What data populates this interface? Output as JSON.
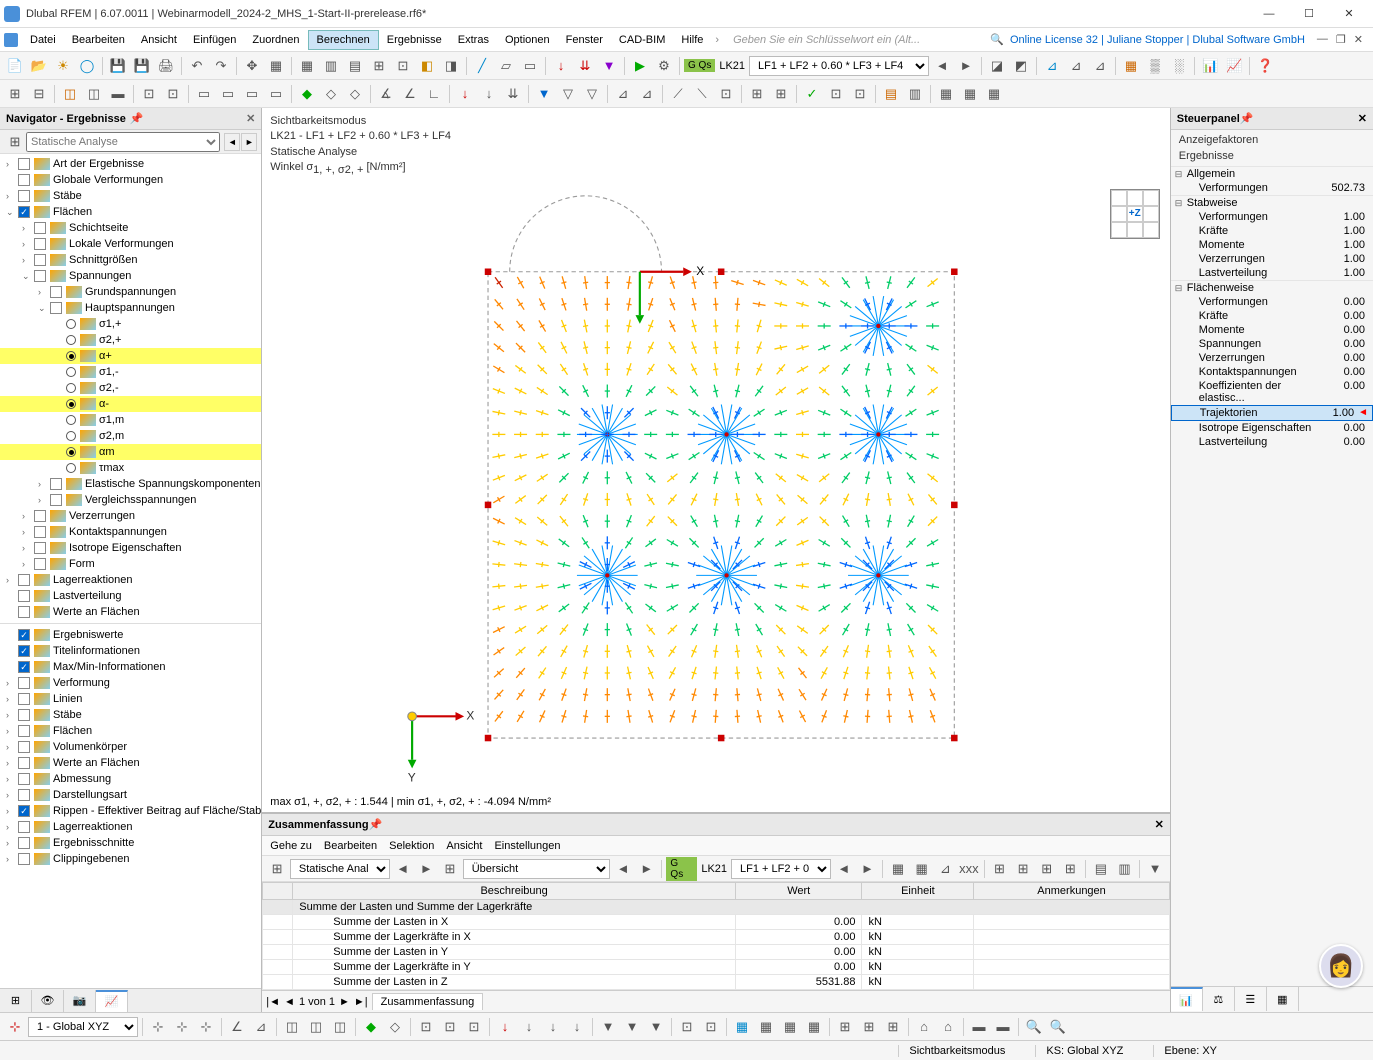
{
  "title": "Dlubal RFEM | 6.07.0011 | Webinarmodell_2024-2_MHS_1-Start-II-prerelease.rf6*",
  "menu": {
    "items": [
      "Datei",
      "Bearbeiten",
      "Ansicht",
      "Einfügen",
      "Zuordnen",
      "Berechnen",
      "Ergebnisse",
      "Extras",
      "Optionen",
      "Fenster",
      "CAD-BIM",
      "Hilfe"
    ],
    "active": "Berechnen",
    "search_placeholder": "Geben Sie ein Schlüsselwort ein (Alt...",
    "license": "Online License 32 | Juliane Stopper | Dlubal Software GmbH"
  },
  "toolbar2": {
    "green": "G Qs",
    "lk": "LK21",
    "combo": "LF1 + LF2 + 0.60 * LF3 + LF4"
  },
  "navigator": {
    "title": "Navigator - Ergebnisse",
    "combo": "Statische Analyse",
    "tree": [
      {
        "ind": 0,
        "exp": ">",
        "chk": false,
        "ico": "list",
        "lbl": "Art der Ergebnisse"
      },
      {
        "ind": 0,
        "exp": "",
        "chk": false,
        "ico": "globe",
        "lbl": "Globale Verformungen"
      },
      {
        "ind": 0,
        "exp": ">",
        "chk": false,
        "ico": "bar",
        "lbl": "Stäbe"
      },
      {
        "ind": 0,
        "exp": "v",
        "chk": true,
        "ico": "surf",
        "lbl": "Flächen"
      },
      {
        "ind": 1,
        "exp": ">",
        "chk": false,
        "ico": "surf",
        "lbl": "Schichtseite"
      },
      {
        "ind": 1,
        "exp": ">",
        "chk": false,
        "ico": "surf",
        "lbl": "Lokale Verformungen"
      },
      {
        "ind": 1,
        "exp": ">",
        "chk": false,
        "ico": "surf",
        "lbl": "Schnittgrößen"
      },
      {
        "ind": 1,
        "exp": "v",
        "chk": false,
        "ico": "surf",
        "lbl": "Spannungen"
      },
      {
        "ind": 2,
        "exp": ">",
        "chk": false,
        "ico": "surf",
        "lbl": "Grundspannungen"
      },
      {
        "ind": 2,
        "exp": "v",
        "chk": false,
        "ico": "surf",
        "lbl": "Hauptspannungen"
      },
      {
        "ind": 3,
        "radio": false,
        "ico": "surf",
        "lbl": "σ1,+"
      },
      {
        "ind": 3,
        "radio": false,
        "ico": "surf",
        "lbl": "σ2,+"
      },
      {
        "ind": 3,
        "radio": true,
        "ico": "surf",
        "lbl": "α+",
        "hl": true
      },
      {
        "ind": 3,
        "radio": false,
        "ico": "surf",
        "lbl": "σ1,-"
      },
      {
        "ind": 3,
        "radio": false,
        "ico": "surf",
        "lbl": "σ2,-"
      },
      {
        "ind": 3,
        "radio": true,
        "ico": "surf",
        "lbl": "α-",
        "hl": true
      },
      {
        "ind": 3,
        "radio": false,
        "ico": "surf",
        "lbl": "σ1,m"
      },
      {
        "ind": 3,
        "radio": false,
        "ico": "surf",
        "lbl": "σ2,m"
      },
      {
        "ind": 3,
        "radio": true,
        "ico": "surf",
        "lbl": "αm",
        "hl": true
      },
      {
        "ind": 3,
        "radio": false,
        "ico": "surf",
        "lbl": "τmax"
      },
      {
        "ind": 2,
        "exp": ">",
        "chk": false,
        "ico": "surf",
        "lbl": "Elastische Spannungskomponenten"
      },
      {
        "ind": 2,
        "exp": ">",
        "chk": false,
        "ico": "surf",
        "lbl": "Vergleichsspannungen"
      },
      {
        "ind": 1,
        "exp": ">",
        "chk": false,
        "ico": "surf",
        "lbl": "Verzerrungen"
      },
      {
        "ind": 1,
        "exp": ">",
        "chk": false,
        "ico": "surf",
        "lbl": "Kontaktspannungen"
      },
      {
        "ind": 1,
        "exp": ">",
        "chk": false,
        "ico": "surf",
        "lbl": "Isotrope Eigenschaften"
      },
      {
        "ind": 1,
        "exp": ">",
        "chk": false,
        "ico": "surf",
        "lbl": "Form"
      },
      {
        "ind": 0,
        "exp": ">",
        "chk": false,
        "ico": "sup",
        "lbl": "Lagerreaktionen"
      },
      {
        "ind": 0,
        "exp": "",
        "chk": false,
        "ico": "load",
        "lbl": "Lastverteilung"
      },
      {
        "ind": 0,
        "exp": "",
        "chk": false,
        "ico": "xx",
        "lbl": "Werte an Flächen"
      },
      {
        "ind": -1,
        "sep": true
      },
      {
        "ind": 0,
        "exp": "",
        "chk": true,
        "ico": "xx",
        "lbl": "Ergebniswerte"
      },
      {
        "ind": 0,
        "exp": "",
        "chk": true,
        "ico": "title",
        "lbl": "Titelinformationen"
      },
      {
        "ind": 0,
        "exp": "",
        "chk": true,
        "ico": "mm",
        "lbl": "Max/Min-Informationen"
      },
      {
        "ind": 0,
        "exp": ">",
        "chk": false,
        "ico": "def",
        "lbl": "Verformung"
      },
      {
        "ind": 0,
        "exp": ">",
        "chk": false,
        "ico": "line",
        "lbl": "Linien"
      },
      {
        "ind": 0,
        "exp": ">",
        "chk": false,
        "ico": "bar",
        "lbl": "Stäbe"
      },
      {
        "ind": 0,
        "exp": ">",
        "chk": false,
        "ico": "surf",
        "lbl": "Flächen"
      },
      {
        "ind": 0,
        "exp": ">",
        "chk": false,
        "ico": "vol",
        "lbl": "Volumenkörper"
      },
      {
        "ind": 0,
        "exp": ">",
        "chk": false,
        "ico": "xx",
        "lbl": "Werte an Flächen"
      },
      {
        "ind": 0,
        "exp": ">",
        "chk": false,
        "ico": "dim",
        "lbl": "Abmessung"
      },
      {
        "ind": 0,
        "exp": ">",
        "chk": false,
        "ico": "disp",
        "lbl": "Darstellungsart"
      },
      {
        "ind": 0,
        "exp": ">",
        "chk": true,
        "ico": "rib",
        "lbl": "Rippen - Effektiver Beitrag auf Fläche/Stab"
      },
      {
        "ind": 0,
        "exp": ">",
        "chk": false,
        "ico": "sup",
        "lbl": "Lagerreaktionen"
      },
      {
        "ind": 0,
        "exp": ">",
        "chk": false,
        "ico": "cut",
        "lbl": "Ergebnisschnitte"
      },
      {
        "ind": 0,
        "exp": ">",
        "chk": false,
        "ico": "clip",
        "lbl": "Clippingebenen"
      }
    ]
  },
  "viewport": {
    "lines": [
      "Sichtbarkeitsmodus",
      "LK21 - LF1 + LF2 + 0.60 * LF3 + LF4",
      "Statische Analyse"
    ],
    "wlabel": "Winkel σ",
    "wsub": "1, +, σ2, +",
    "wunit": "[N/mm²]",
    "orient": "+Z",
    "minmax": "max σ1, +, σ2, + : 1.544 | min σ1, +, σ2, + : -4.094 N/mm²"
  },
  "summary": {
    "title": "Zusammenfassung",
    "menu": [
      "Gehe zu",
      "Bearbeiten",
      "Selektion",
      "Ansicht",
      "Einstellungen"
    ],
    "tb": {
      "combo1": "Statische Anal...",
      "combo2": "Übersicht",
      "green": "G Qs",
      "lk": "LK21",
      "lf": "LF1 + LF2 + 0..."
    },
    "headers": [
      "Beschreibung",
      "Wert",
      "Einheit",
      "Anmerkungen"
    ],
    "group": "Summe der Lasten und Summe der Lagerkräfte",
    "rows": [
      {
        "d": "Summe der Lasten in X",
        "v": "0.00",
        "u": "kN"
      },
      {
        "d": "Summe der Lagerkräfte in X",
        "v": "0.00",
        "u": "kN"
      },
      {
        "d": "Summe der Lasten in Y",
        "v": "0.00",
        "u": "kN"
      },
      {
        "d": "Summe der Lagerkräfte in Y",
        "v": "0.00",
        "u": "kN"
      },
      {
        "d": "Summe der Lasten in Z",
        "v": "5531.88",
        "u": "kN"
      }
    ],
    "pager": "1 von 1",
    "tab": "Zusammenfassung"
  },
  "control": {
    "title": "Steuerpanel",
    "sub1": "Anzeigefaktoren",
    "sub2": "Ergebnisse",
    "groups": [
      {
        "name": "Allgemein",
        "items": [
          {
            "l": "Verformungen",
            "v": "502.73"
          }
        ]
      },
      {
        "name": "Stabweise",
        "items": [
          {
            "l": "Verformungen",
            "v": "1.00"
          },
          {
            "l": "Kräfte",
            "v": "1.00"
          },
          {
            "l": "Momente",
            "v": "1.00"
          },
          {
            "l": "Verzerrungen",
            "v": "1.00"
          },
          {
            "l": "Lastverteilung",
            "v": "1.00"
          }
        ]
      },
      {
        "name": "Flächenweise",
        "items": [
          {
            "l": "Verformungen",
            "v": "0.00"
          },
          {
            "l": "Kräfte",
            "v": "0.00"
          },
          {
            "l": "Momente",
            "v": "0.00"
          },
          {
            "l": "Spannungen",
            "v": "0.00"
          },
          {
            "l": "Verzerrungen",
            "v": "0.00"
          },
          {
            "l": "Kontaktspannungen",
            "v": "0.00"
          },
          {
            "l": "Koeffizienten der elastisc...",
            "v": "0.00"
          },
          {
            "l": "Trajektorien",
            "v": "1.00",
            "sel": true
          },
          {
            "l": "Isotrope Eigenschaften",
            "v": "0.00"
          },
          {
            "l": "Lastverteilung",
            "v": "0.00"
          }
        ]
      }
    ]
  },
  "status": {
    "s1": "Sichtbarkeitsmodus",
    "s2": "KS: Global XYZ",
    "s3": "Ebene: XY"
  },
  "bstatus": {
    "wcs": "1 - Global XYZ"
  }
}
